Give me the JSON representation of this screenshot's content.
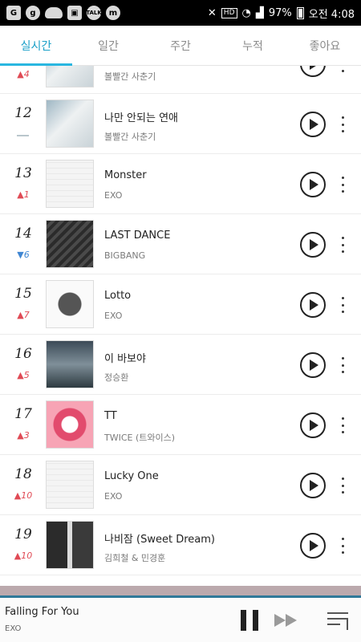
{
  "status_bar": {
    "left_icons": [
      "G",
      "g",
      "cloud",
      "img",
      "TALK",
      "m"
    ],
    "hd": "HD",
    "battery": "97%",
    "time": "오전 4:08"
  },
  "tabs": [
    {
      "label": "실시간",
      "active": true
    },
    {
      "label": "일간",
      "active": false
    },
    {
      "label": "주간",
      "active": false
    },
    {
      "label": "누적",
      "active": false
    },
    {
      "label": "좋아요",
      "active": false
    }
  ],
  "songs": [
    {
      "rank": "",
      "change_dir": "up",
      "change": "4",
      "title": "",
      "artist": "볼빨간 사춘기",
      "cover": "bolbbalgan"
    },
    {
      "rank": "12",
      "change_dir": "same",
      "change": "",
      "title": "나만 안되는 연애",
      "artist": "볼빨간 사춘기",
      "cover": "bolbbalgan"
    },
    {
      "rank": "13",
      "change_dir": "up",
      "change": "1",
      "title": "Monster",
      "artist": "EXO",
      "cover": "exo"
    },
    {
      "rank": "14",
      "change_dir": "down",
      "change": "6",
      "title": "LAST DANCE",
      "artist": "BIGBANG",
      "cover": "bigbang"
    },
    {
      "rank": "15",
      "change_dir": "up",
      "change": "7",
      "title": "Lotto",
      "artist": "EXO",
      "cover": "lotto"
    },
    {
      "rank": "16",
      "change_dir": "up",
      "change": "5",
      "title": "이 바보야",
      "artist": "정승환",
      "cover": "forest"
    },
    {
      "rank": "17",
      "change_dir": "up",
      "change": "3",
      "title": "TT",
      "artist": "TWICE (트와이스)",
      "cover": "twice"
    },
    {
      "rank": "18",
      "change_dir": "up",
      "change": "10",
      "title": "Lucky One",
      "artist": "EXO",
      "cover": "exo"
    },
    {
      "rank": "19",
      "change_dir": "up",
      "change": "10",
      "title": "나비잠 (Sweet Dream)",
      "artist": "김희철 & 민경훈",
      "cover": "duo"
    }
  ],
  "player": {
    "title": "Falling For You",
    "artist": "EXO"
  },
  "colors": {
    "accent": "#29b6e0",
    "up": "#e04a55",
    "down": "#3f86d2"
  }
}
